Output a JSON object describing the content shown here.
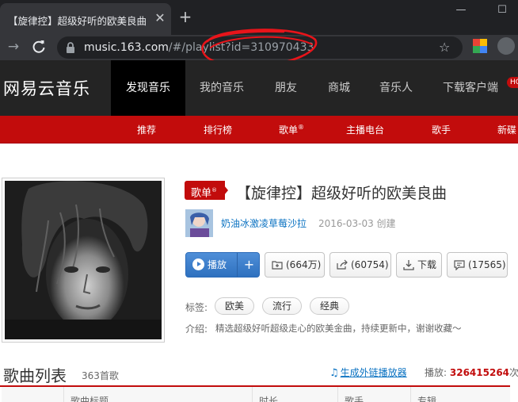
{
  "browser": {
    "tab_title": "【旋律控】超级好听的欧美良曲",
    "tab_close": "✕",
    "new_tab": "+",
    "url_host": "music.163.com",
    "url_path": "/#/playlist?id=310970433",
    "icons": [
      "back-arrow-icon",
      "reload-icon",
      "lock-icon",
      "star-icon",
      "extension-icon",
      "profile-icon",
      "minimize-icon",
      "maximize-icon"
    ]
  },
  "header": {
    "logo": "网易云音乐",
    "nav": [
      "发现音乐",
      "我的音乐",
      "朋友",
      "商城",
      "音乐人",
      "下载客户端"
    ],
    "hot_badge": "HOT"
  },
  "subnav": {
    "items": [
      "推荐",
      "排行榜",
      "歌单",
      "主播电台",
      "歌手",
      "新碟"
    ],
    "registered": "®"
  },
  "playlist": {
    "tag": "歌单",
    "tag_mark": "®",
    "title": "【旋律控】超级好听的欧美良曲",
    "creator": "奶油冰激凌草莓沙拉",
    "created": "2016-03-03 创建",
    "buttons": {
      "play": "播放",
      "add": "+",
      "collect": "(664万)",
      "share": "(60754)",
      "download": "下载",
      "comment": "(17565)"
    },
    "tags_label": "标签:",
    "tags": [
      "欧美",
      "流行",
      "经典"
    ],
    "intro_label": "介绍:",
    "intro": "精选超级好听超级走心的欧美金曲，持续更新中，谢谢收藏～"
  },
  "songlist": {
    "title": "歌曲列表",
    "count": "363首歌",
    "outchain": "生成外链播放器",
    "play_label": "播放:",
    "play_count": "326415264",
    "play_unit": "次",
    "columns": [
      "歌曲标题",
      "时长",
      "歌手",
      "专辑"
    ]
  },
  "colors": {
    "brand_red": "#c20c0c",
    "header_dark": "#242424",
    "link_blue": "#0c73c2",
    "annotation_red": "#e8141a"
  }
}
